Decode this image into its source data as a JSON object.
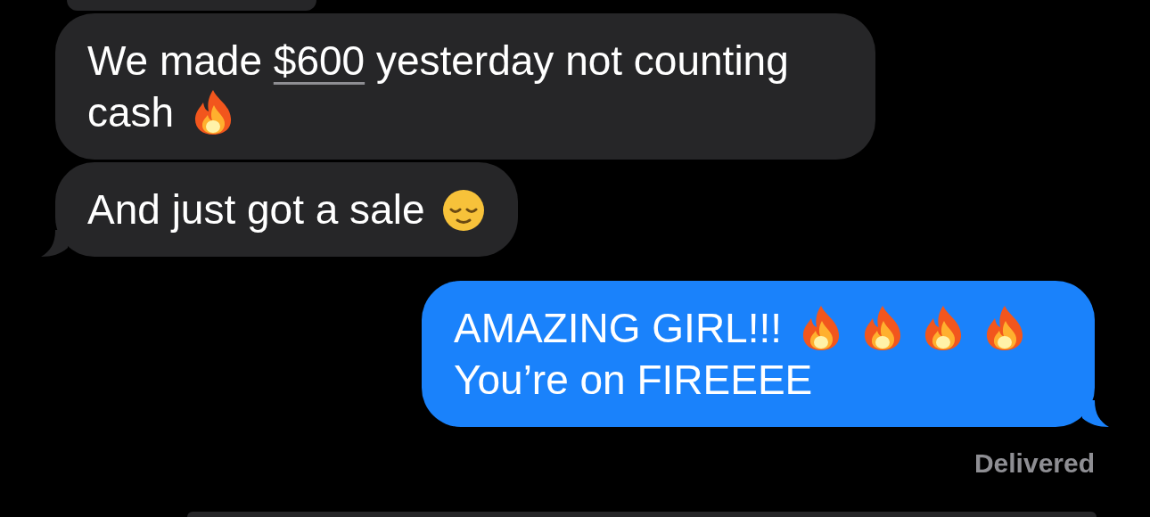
{
  "messages": [
    {
      "kind": "partial",
      "sent": false
    },
    {
      "kind": "message",
      "sent": false,
      "tail": false,
      "content": [
        {
          "kind": "text",
          "parts": [
            {
              "text": "We made "
            },
            {
              "text": "$600",
              "link": true
            },
            {
              "text": " yesterday not counting cash"
            }
          ]
        },
        {
          "kind": "fire"
        }
      ]
    },
    {
      "kind": "message",
      "sent": false,
      "tail": true,
      "content": [
        {
          "kind": "text",
          "parts": [
            {
              "text": "And just got a sale"
            }
          ]
        },
        {
          "kind": "relieved"
        }
      ]
    },
    {
      "kind": "message",
      "sent": true,
      "tail": true,
      "receipt": "Delivered",
      "content": [
        {
          "kind": "text",
          "parts": [
            {
              "text": "AMAZING GIRL!!!"
            }
          ]
        },
        {
          "kind": "fire"
        },
        {
          "kind": "fire"
        },
        {
          "kind": "fire"
        },
        {
          "kind": "fire"
        },
        {
          "kind": "text",
          "parts": [
            {
              "text": "You’re on FIREEEE"
            }
          ]
        }
      ]
    },
    {
      "kind": "partial",
      "sent": true
    }
  ]
}
